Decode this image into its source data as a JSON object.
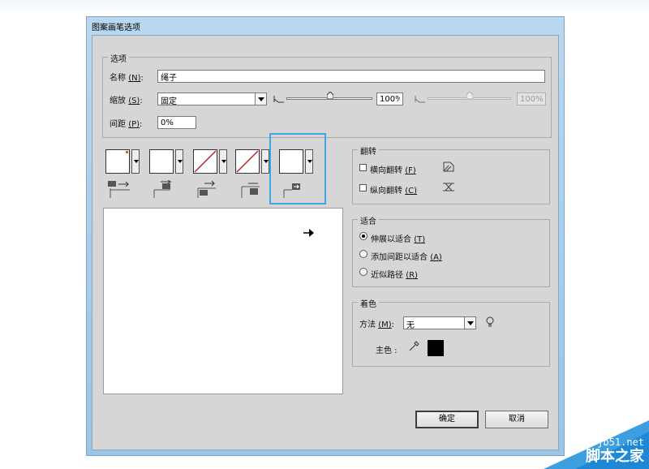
{
  "window": {
    "title": "图案画笔选项"
  },
  "options_group": {
    "label": "选项",
    "name_label_pre": "名称",
    "name_label_key": "(N)",
    "name_label_post": ":",
    "name_value": "绳子",
    "scale_label_pre": "缩放",
    "scale_label_key": "(S)",
    "scale_label_post": ":",
    "scale_select": "固定",
    "scale_value1": "100%",
    "scale_value2": "100%",
    "spacing_label_pre": "间距",
    "spacing_label_key": "(P)",
    "spacing_label_post": ":",
    "spacing_value": "0%"
  },
  "flip_group": {
    "label": "翻转",
    "horizontal": {
      "text": "横向翻转",
      "key": "(F)",
      "checked": false
    },
    "vertical": {
      "text": "纵向翻转",
      "key": "(C)",
      "checked": false
    }
  },
  "fit_group": {
    "label": "适合",
    "options": [
      {
        "text": "伸展以适合",
        "key": "(T)",
        "selected": true
      },
      {
        "text": "添加间距以适合",
        "key": "(A)",
        "selected": false
      },
      {
        "text": "近似路径",
        "key": "(R)",
        "selected": false
      }
    ]
  },
  "color_group": {
    "label": "着色",
    "method_label_pre": "方法",
    "method_label_key": "(M)",
    "method_label_post": ":",
    "method_value": "无",
    "key_color_label": "主色 :",
    "key_color": "#000000"
  },
  "buttons": {
    "ok": "确定",
    "cancel": "取消"
  },
  "watermark": {
    "domain": "jb51.net",
    "name": "脚本之家"
  },
  "accent": "#3ea7e0"
}
